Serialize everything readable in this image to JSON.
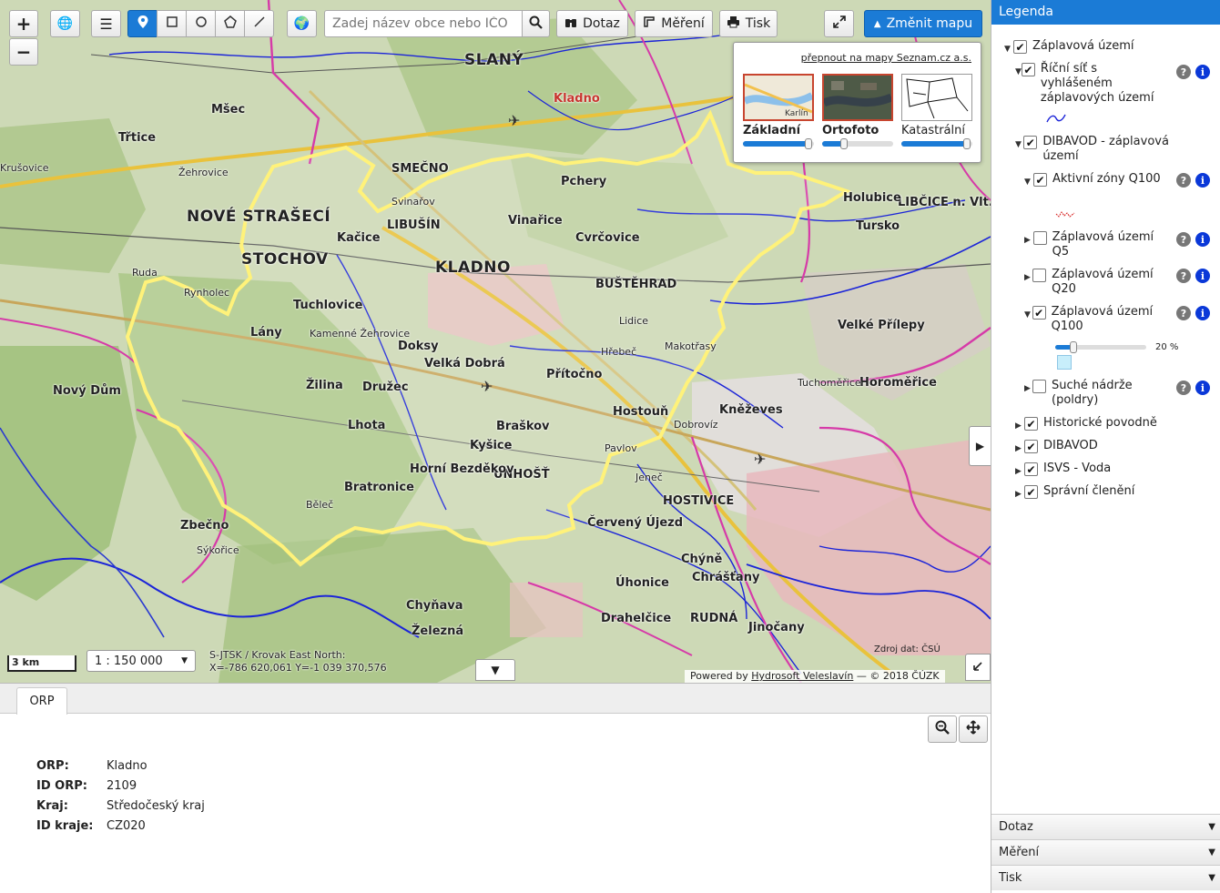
{
  "toolbar": {
    "zoom_in": "+",
    "zoom_out": "−",
    "search_placeholder": "Zadej název obce nebo IČO",
    "query_label": "Dotaz",
    "measure_label": "Měření",
    "print_label": "Tisk",
    "change_map_label": "Změnit mapu"
  },
  "basemap_switcher": {
    "seznam_link": "přepnout na mapy Seznam.cz a.s.",
    "options": [
      {
        "label": "Základní",
        "opacity": 1.0,
        "selected": true
      },
      {
        "label": "Ortofoto",
        "opacity": 0.3,
        "selected": true
      },
      {
        "label": "Katastrální",
        "opacity": 1.0,
        "selected": false
      }
    ],
    "thumb_text": "Karlín"
  },
  "map": {
    "scale_bar": "3 km",
    "scale_value": "1 : 150 000",
    "crs_line1": "S-JTSK / Krovak East North:",
    "crs_line2": "X=-786 620,061 Y=-1 039 370,576",
    "powered_prefix": "Powered by ",
    "powered_link": "Hydrosoft Veleslavín",
    "powered_suffix": " — © 2018 ČÚZK",
    "source_note": "Zdroj dat: ČSÚ",
    "labels": {
      "kladno": "KLADNO",
      "slany": "SLANÝ",
      "smecno": "SMEČNO",
      "busterad": "BUŠTĚHRAD",
      "unhost": "UNHOŠŤ",
      "hostivice": "HOSTIVICE",
      "rudna": "RUDNÁ",
      "libusin": "LIBUŠÍN",
      "nove_straseci": "NOVÉ STRAŠECÍ",
      "stochov": "STOCHOV",
      "libcice": "LIBČICE n. Vlt.",
      "velke_prilepy": "Velké Přílepy",
      "horomerice": "Horoměřice",
      "kneževes": "Kněževes",
      "tuchomerice": "Tuchoměřice",
      "pcherý": "Pchery",
      "vinarice": "Vinařice",
      "cvrcovice": "Cvrčovice",
      "kacice": "Kačice",
      "lany": "Lány",
      "doksy": "Doksy",
      "velka_dobra": "Velká Dobrá",
      "pritocno": "Přítočno",
      "hostoun": "Hostouň",
      "braskov": "Braškov",
      "kysice": "Kyšice",
      "horni_bezdekov": "Horní Bezděkov",
      "bratronice": "Bratronice",
      "zilina": "Žilina",
      "druzec": "Družec",
      "lhota": "Lhota",
      "novy_dum": "Nový Dům",
      "belec": "Běleč",
      "zbecno": "Zbečno",
      "sykorice": "Sýkořice",
      "chynava": "Chyňava",
      "zelezna": "Železná",
      "cerveny_ujezd": "Červený Újezd",
      "uhonice": "Úhonice",
      "chyne": "Chýně",
      "chrastany": "Chrášťany",
      "drahelcice": "Drahelčice",
      "jinocany": "Jinočany",
      "mseč": "Mšec",
      "trtice": "Třtice",
      "krusovice": "Krušovice",
      "zehrovice": "Žehrovice",
      "ruda": "Ruda",
      "rynholec": "Rynholec",
      "tuchlovice": "Tuchlovice",
      "kamenne_zehrovice": "Kamenné Žehrovice",
      "svinarov": "Svinařov",
      "lidice": "Lidice",
      "hrebec": "Hřebeč",
      "makotrasy": "Makotřasy",
      "dobrovíz": "Dobrovíz",
      "jeneč": "Jeneč",
      "pavlov": "Pavlov",
      "tursko": "Tursko",
      "holubice": "Holubice",
      "kladno_red": "Kladno"
    }
  },
  "bottom_panel": {
    "tab": "ORP",
    "rows": [
      {
        "key": "ORP:",
        "value": "Kladno"
      },
      {
        "key": "ID ORP:",
        "value": "2109"
      },
      {
        "key": "Kraj:",
        "value": "Středočeský kraj"
      },
      {
        "key": "ID kraje:",
        "value": "CZ020"
      }
    ]
  },
  "sidebar": {
    "title": "Legenda",
    "items": {
      "zaplavova_uzemi": "Záplavová území",
      "ricni_sit": "Říční síť s vyhlášeném záplavových území",
      "dibavod_zaplavova": "DIBAVOD - záplavová území",
      "aktivni_zony": "Aktivní zóny Q100",
      "q5": "Záplavová území Q5",
      "q20": "Záplavová území Q20",
      "q100": "Záplavová území Q100",
      "q100_opacity": "20 %",
      "suche_nadrze": "Suché nádrže (poldry)",
      "historicke_povodne": "Historické povodně",
      "dibavod": "DIBAVOD",
      "isvs": "ISVS - Voda",
      "spravni_cleneni": "Správní členění"
    },
    "help_glyph": "?",
    "info_glyph": "i",
    "accordion": [
      "Dotaz",
      "Měření",
      "Tisk"
    ]
  },
  "colors": {
    "accent": "#1b7bd6",
    "orp_boundary": "#fff27a",
    "district_boundary": "#d63aa8",
    "rivers": "#1b24d8",
    "urban": "#e7b8bd",
    "forest": "#9fbf7a"
  }
}
